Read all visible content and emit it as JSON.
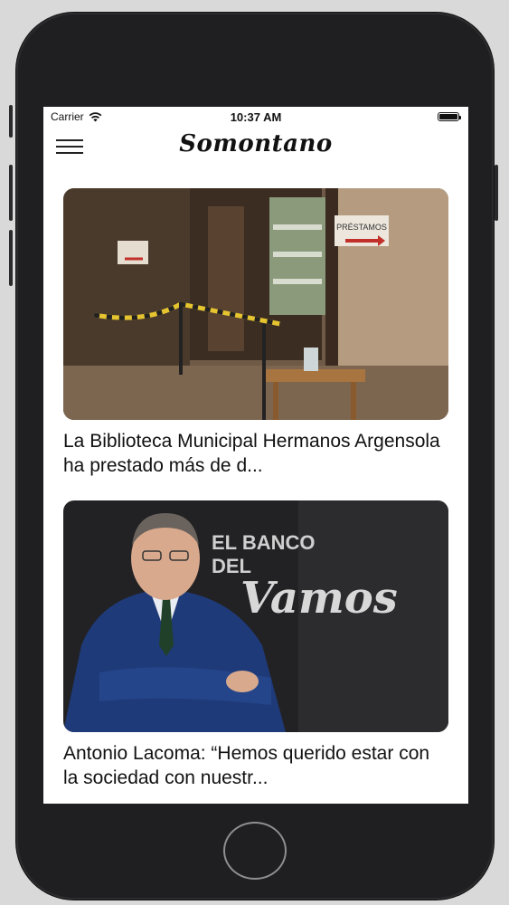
{
  "status_bar": {
    "carrier": "Carrier",
    "time": "10:37 AM",
    "wifi_icon": "wifi-icon",
    "battery_icon": "battery-full-icon"
  },
  "nav": {
    "title": "Somontano",
    "menu_icon": "hamburger-menu-icon"
  },
  "articles": [
    {
      "title": "La Biblioteca Municipal Hermanos Argensola ha prestado más de d...",
      "image_sign": "PRÉSTAMOS",
      "image_desc": "library-entrance-photo"
    },
    {
      "title": "Antonio Lacoma: “Hemos querido estar  con la sociedad con nuestr...",
      "image_wall_text_1": "EL BANCO",
      "image_wall_text_2": "DEL",
      "image_wall_text_3": "Vamos",
      "image_desc": "man-portrait-photo"
    }
  ],
  "colors": {
    "device_frame": "#1f1f21",
    "screen_bg": "#ffffff",
    "text": "#111111"
  }
}
